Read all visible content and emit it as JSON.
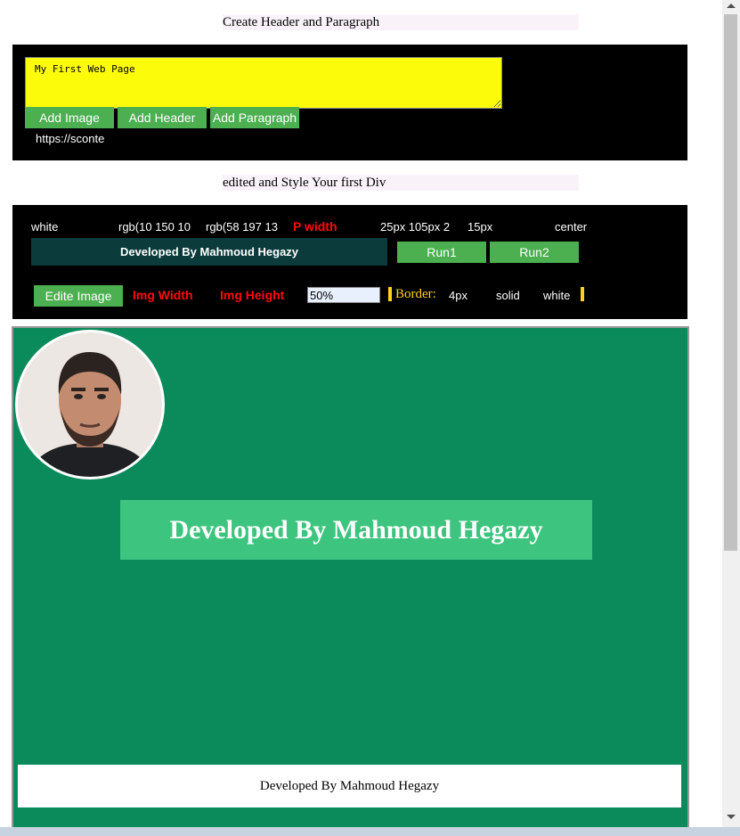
{
  "section1": {
    "title": "Create Header and Paragraph"
  },
  "editor": {
    "text_value": "My First Web Page",
    "buttons": {
      "add_image": "Add Image",
      "add_header": "Add Header",
      "add_paragraph": "Add Paragraph"
    },
    "url_text": "https://sconte"
  },
  "section2": {
    "title": "edited and Style Your first Div"
  },
  "style": {
    "color_value": "white",
    "bg_value": "rgb(10 150 10",
    "bg2_value": "rgb(58 197 13",
    "p_width_label": "P width",
    "padding_value": "25px 105px 2",
    "radius_value": "15px",
    "align_value": "center",
    "preview_text": "Developed By Mahmoud Hegazy",
    "run1": "Run1",
    "run2": "Run2"
  },
  "image_edit": {
    "button": "Edite Image",
    "width_label": "Img Width",
    "height_label": "Img Height",
    "size_value": "50%",
    "border_label": "Border:",
    "border_width": "4px",
    "border_style": "solid",
    "border_color": "white"
  },
  "preview": {
    "headline": "Developed By Mahmoud Hegazy",
    "footer": "Developed By Mahmoud Hegazy",
    "background": "#0b8b5c",
    "headline_bg": "#3dc47e"
  },
  "colors": {
    "button_green": "#4caf50",
    "textarea_yellow": "#fbfb0a",
    "accent_yellow": "#ffd21f",
    "label_red": "#ff0a0a"
  }
}
